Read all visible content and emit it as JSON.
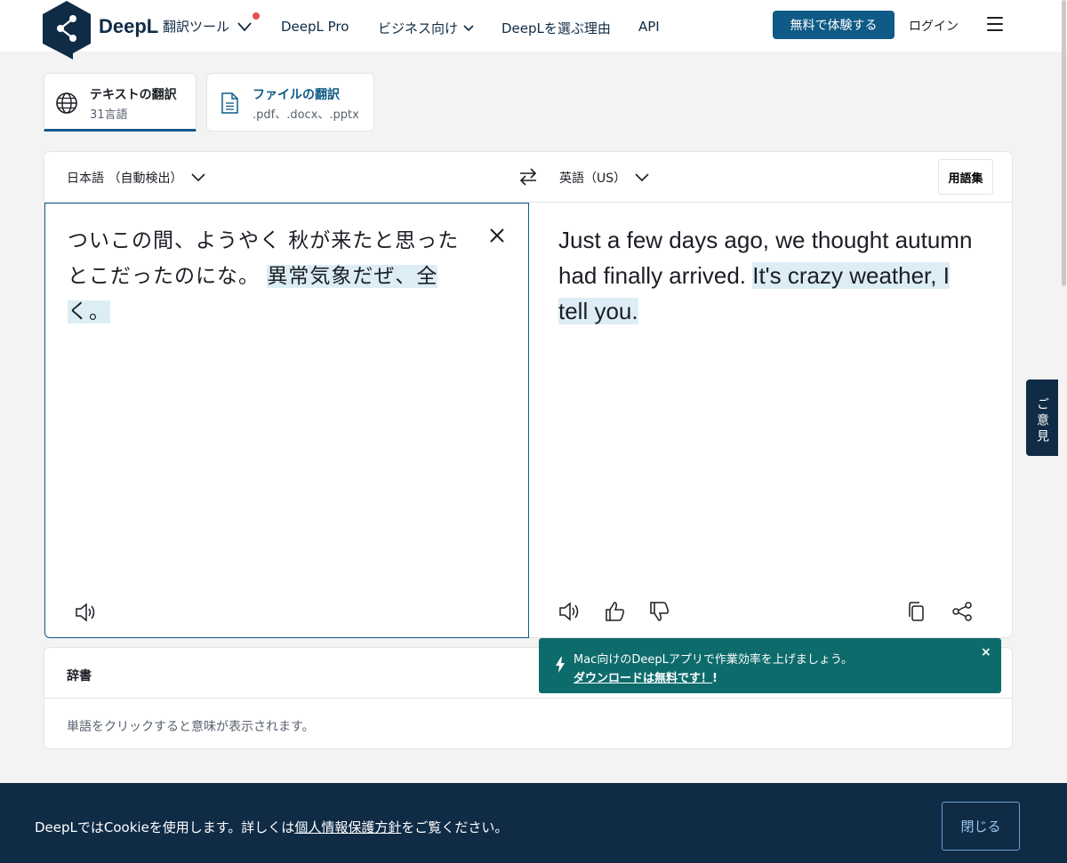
{
  "header": {
    "brand": "DeepL",
    "tool_menu_label": "翻訳ツール",
    "nav": {
      "pro": "DeepL Pro",
      "business": "ビジネス向け",
      "why": "DeepLを選ぶ理由",
      "api": "API"
    },
    "trial_button": "無料で体験する",
    "login": "ログイン"
  },
  "modes": {
    "text": {
      "title": "テキストの翻訳",
      "subtitle": "31言語"
    },
    "file": {
      "title": "ファイルの翻訳",
      "subtitle": ".pdf、.docx、.pptx"
    }
  },
  "translator": {
    "source_lang": "日本語 （自動検出）",
    "target_lang": "英語（US）",
    "glossary": "用語集",
    "source_text_plain": "ついこの間、ようやく 秋が来たと思ったとこだったのにな。",
    "source_text_highlight": "異常気象だぜ、全く。",
    "target_text_plain": "Just a few days ago, we thought autumn had finally arrived.",
    "target_text_highlight": "It's crazy weather, I tell you."
  },
  "dictionary": {
    "title": "辞書",
    "hint": "単語をクリックすると意味が表示されます。"
  },
  "toast": {
    "message": "Mac向けのDeepLアプリで作業効率を上げましょう。",
    "link": "ダウンロードは無料です！",
    "link_suffix": "!",
    "close": "×"
  },
  "feedback_tab": "ご意見",
  "cookie": {
    "text_before": "DeepLではCookieを使用します。詳しくは",
    "link": "個人情報保護方針",
    "text_after": "をご覧ください。",
    "close_button": "閉じる"
  },
  "colors": {
    "brand_navy": "#0f2b46",
    "accent_blue": "#0f5a87",
    "toast_teal": "#0e6b6b",
    "highlight": "#dcedf5",
    "notification_dot": "#e55050"
  },
  "icons": {
    "logo": "deepl-logo-icon",
    "globe": "globe-icon",
    "document": "document-icon",
    "swap": "swap-icon",
    "speaker": "speaker-icon",
    "thumbs_up": "thumbs-up-icon",
    "thumbs_down": "thumbs-down-icon",
    "copy": "copy-icon",
    "share": "share-icon",
    "bolt": "bolt-icon"
  }
}
